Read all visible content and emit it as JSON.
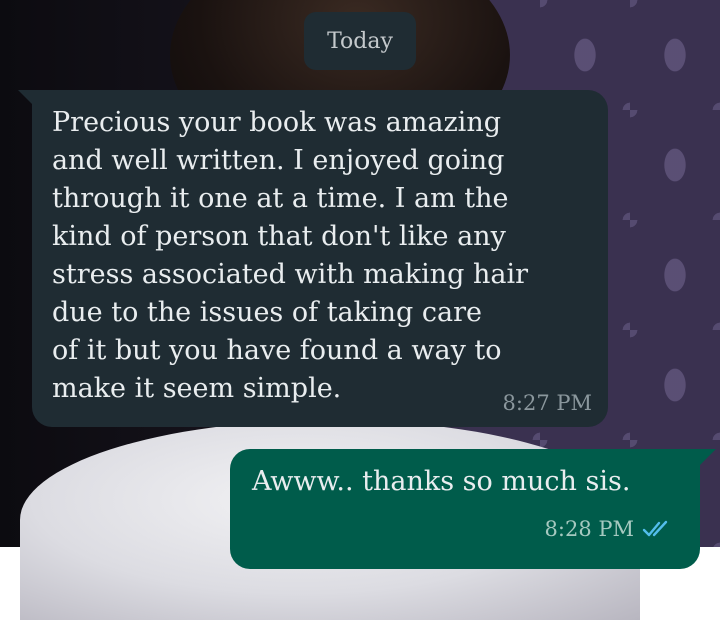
{
  "date_chip": {
    "label": "Today"
  },
  "messages": [
    {
      "direction": "incoming",
      "text": "Precious your book was amazing\nand well written. I enjoyed going\nthrough it one at a time. I am the\nkind of person that don't like any\nstress associated with making hair\ndue to the issues of taking care\nof it but you have found a way to\nmake it seem simple.",
      "time": "8:27 PM"
    },
    {
      "direction": "outgoing",
      "text": "Awww.. thanks so much sis.",
      "time": "8:28 PM",
      "status_icon": "double-check-read-icon"
    }
  ],
  "colors": {
    "incoming_bubble": "#1f2c33",
    "outgoing_bubble": "#005c4b",
    "read_tick": "#53bdeb",
    "text": "#e9edef"
  }
}
